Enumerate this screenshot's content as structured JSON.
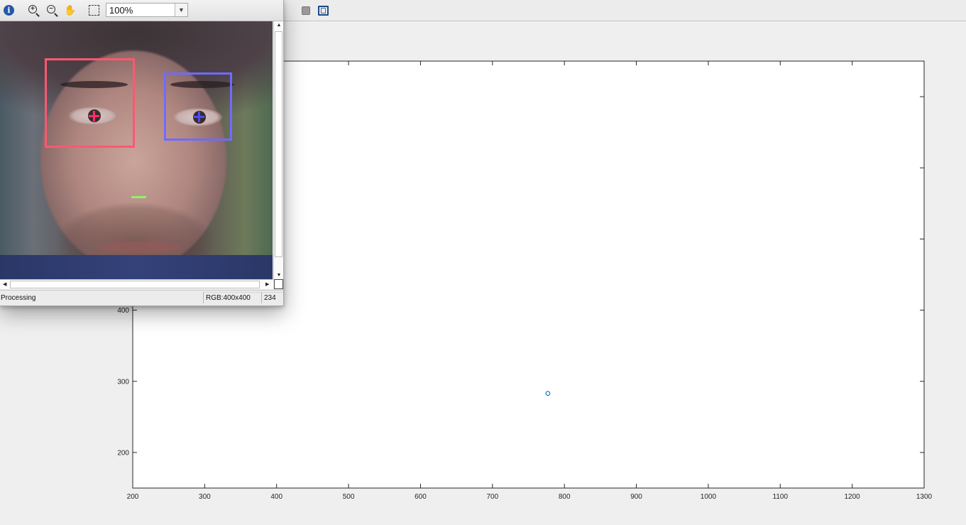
{
  "figure_toolbar": {
    "icons": [
      "square-icon",
      "frame-icon"
    ]
  },
  "viewer": {
    "zoom_value": "100%",
    "status_text": "Processing",
    "pixel_info": "RGB:400x400",
    "pixel_value": "234",
    "icons": [
      "info-icon",
      "zoom-in-icon",
      "zoom-out-icon",
      "pan-hand-icon",
      "fit-to-window-icon"
    ]
  },
  "chart_data": {
    "type": "scatter",
    "title": "",
    "xlabel": "",
    "ylabel": "",
    "xlim": [
      200,
      1300
    ],
    "ylim": [
      150,
      750
    ],
    "x_ticks": [
      200,
      300,
      400,
      500,
      600,
      700,
      800,
      900,
      1000,
      1100,
      1200,
      1300
    ],
    "y_ticks": [
      200,
      300,
      400
    ],
    "series": [
      {
        "x": [
          777
        ],
        "y": [
          283
        ],
        "marker": "o",
        "color": "#0072bd"
      }
    ],
    "grid": false,
    "box": true
  }
}
